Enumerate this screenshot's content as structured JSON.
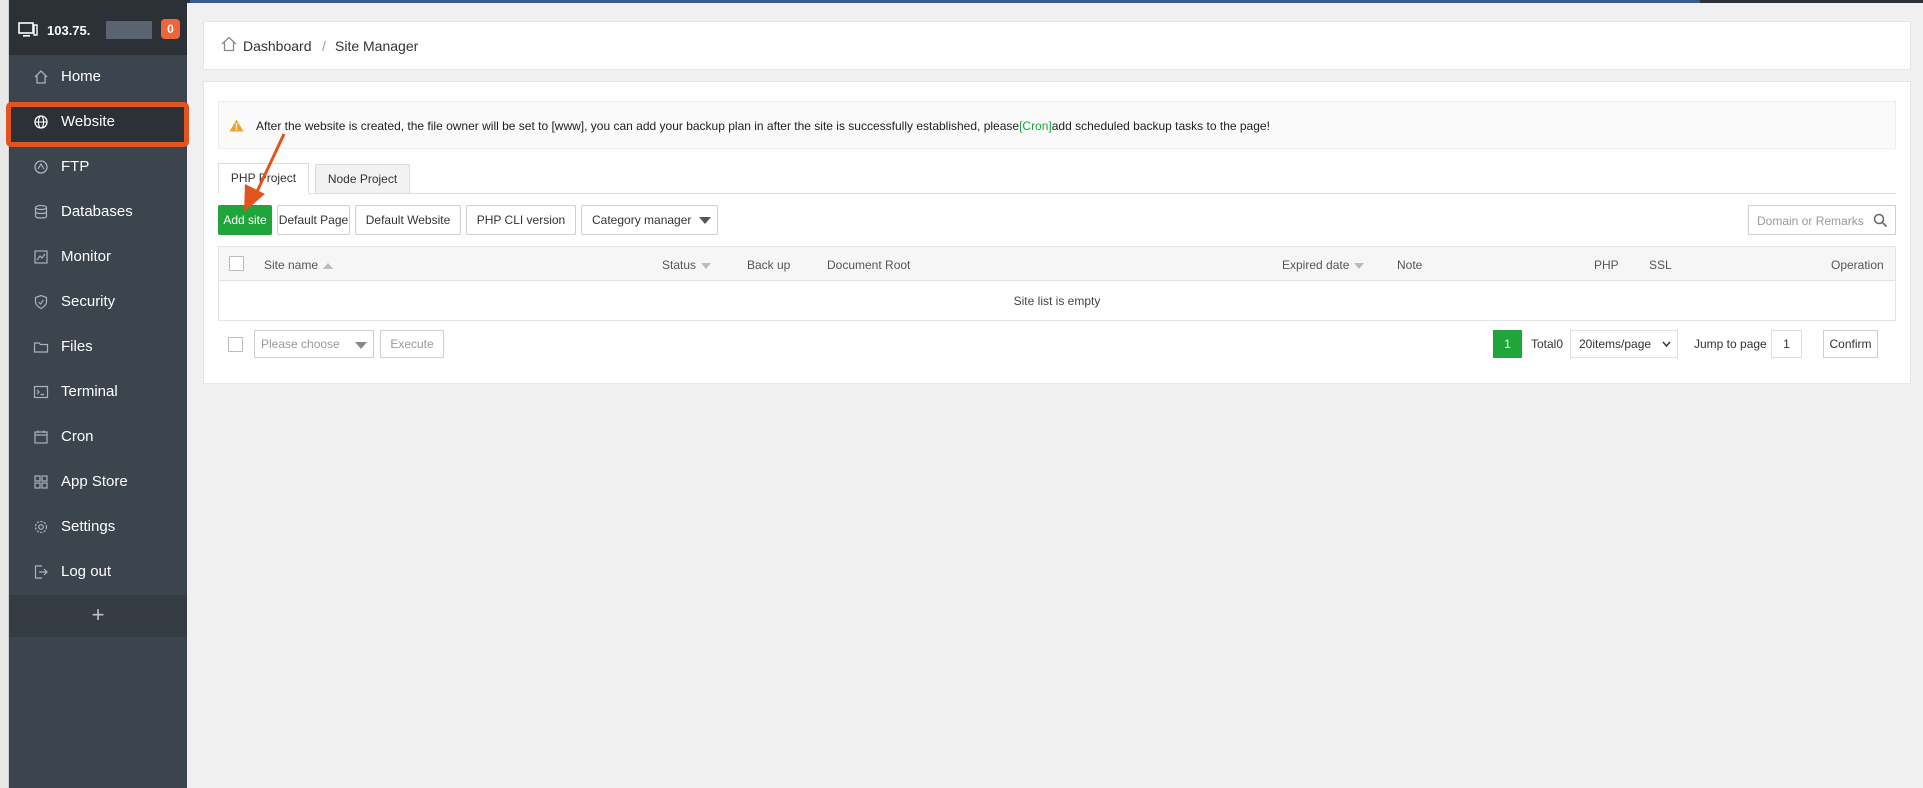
{
  "server": {
    "ip": "103.75.",
    "badge": "0"
  },
  "sidebar": {
    "items": [
      {
        "label": "Home",
        "icon": "home-icon"
      },
      {
        "label": "Website",
        "icon": "globe-icon"
      },
      {
        "label": "FTP",
        "icon": "ftp-icon"
      },
      {
        "label": "Databases",
        "icon": "database-icon"
      },
      {
        "label": "Monitor",
        "icon": "monitor-icon"
      },
      {
        "label": "Security",
        "icon": "shield-icon"
      },
      {
        "label": "Files",
        "icon": "folder-icon"
      },
      {
        "label": "Terminal",
        "icon": "terminal-icon"
      },
      {
        "label": "Cron",
        "icon": "calendar-icon"
      },
      {
        "label": "App Store",
        "icon": "grid-icon"
      },
      {
        "label": "Settings",
        "icon": "gear-icon"
      },
      {
        "label": "Log out",
        "icon": "logout-icon"
      }
    ],
    "active": "Website",
    "add": "+"
  },
  "breadcrumb": {
    "home": "Dashboard",
    "separator": "/",
    "current": "Site Manager"
  },
  "notice": {
    "prefix": "After the website is created, the file owner will be set to [www], you can add your backup plan in after the site is successfully established, please",
    "link": "[Cron]",
    "suffix": "add scheduled backup tasks to the page!"
  },
  "tabs": [
    {
      "label": "PHP Project",
      "active": true
    },
    {
      "label": "Node Project",
      "active": false
    }
  ],
  "toolbar": {
    "add_site": "Add site",
    "default_page": "Default Page",
    "default_website": "Default Website",
    "php_cli": "PHP CLI version",
    "category_manager": "Category manager",
    "search_placeholder": "Domain or Remarks"
  },
  "table": {
    "columns": [
      "Site name",
      "Status",
      "Back up",
      "Document Root",
      "Expired date",
      "Note",
      "PHP",
      "SSL",
      "Operation"
    ],
    "empty_text": "Site list is empty"
  },
  "footer": {
    "batch_placeholder": "Please choose",
    "execute": "Execute",
    "current_page": "1",
    "total": "Total0",
    "per_page": "20items/page",
    "jump_label": "Jump to page",
    "jump_value": "1",
    "confirm": "Confirm"
  },
  "colors": {
    "accent": "#20a53a",
    "highlight": "#e2531e",
    "sidebar": "#3c444d"
  }
}
